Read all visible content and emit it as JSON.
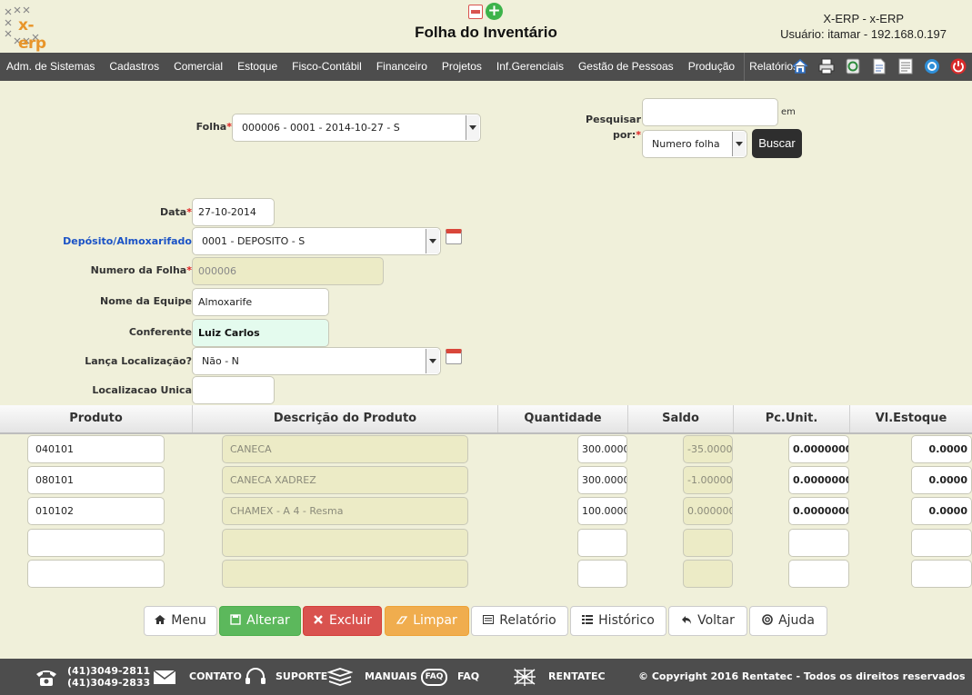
{
  "app": {
    "logo_text": "x-erp",
    "title": "Folha do Inventário",
    "user_line1": "X-ERP - x-ERP",
    "user_line2": "Usuário: itamar - 192.168.0.197"
  },
  "nav": {
    "items": [
      "Adm. de Sistemas",
      "Cadastros",
      "Comercial",
      "Estoque",
      "Fisco-Contábil",
      "Financeiro",
      "Projetos",
      "Inf.Gerenciais",
      "Gestão de Pessoas",
      "Produção",
      "Relatórios"
    ],
    "icons": [
      "home-icon",
      "print-icon",
      "recycle-icon",
      "document-icon",
      "list-icon",
      "help-icon",
      "power-icon"
    ]
  },
  "form": {
    "folha_label": "Folha",
    "folha_value": "000006 - 0001 - 2014-10-27 - S",
    "pesquisar_label": "Pesquisar",
    "por_label": "por:",
    "search_value": "",
    "em_label": "em",
    "search_by_value": "Numero folha",
    "buscar_label": "Buscar",
    "data_label": "Data",
    "data_value": "27-10-2014",
    "deposito_label": "Depósito/Almoxarifado",
    "deposito_value": "0001 - DEPOSITO - S",
    "numero_label": "Numero da Folha",
    "numero_value": "000006",
    "equipe_label": "Nome da Equipe",
    "equipe_value": "Almoxarife",
    "conferente_label": "Conferente",
    "conferente_value": "Luiz Carlos",
    "lanca_label": "Lança Localização?",
    "lanca_value": "Não - N",
    "localizacao_label": "Localizacao Unica",
    "localizacao_value": ""
  },
  "table": {
    "headers": [
      "Produto",
      "Descrição do Produto",
      "Quantidade",
      "Saldo",
      "Pc.Unit.",
      "Vl.Estoque"
    ],
    "rows": [
      {
        "produto": "040101",
        "descricao": "CANECA",
        "quantidade": "300.0000",
        "saldo": "-35.0000",
        "pcunit": "0.00000000",
        "vlestoque": "0.0000"
      },
      {
        "produto": "080101",
        "descricao": "CANECA  XADREZ",
        "quantidade": "300.0000",
        "saldo": "-1.00000",
        "pcunit": "0.00000000",
        "vlestoque": "0.0000"
      },
      {
        "produto": "010102",
        "descricao": "CHAMEX - A 4 - Resma",
        "quantidade": "100.0000",
        "saldo": "0.000000",
        "pcunit": "0.00000000",
        "vlestoque": "0.0000"
      },
      {
        "produto": "",
        "descricao": "",
        "quantidade": "",
        "saldo": "",
        "pcunit": "",
        "vlestoque": ""
      },
      {
        "produto": "",
        "descricao": "",
        "quantidade": "",
        "saldo": "",
        "pcunit": "",
        "vlestoque": ""
      }
    ]
  },
  "actions": {
    "menu": "Menu",
    "alterar": "Alterar",
    "excluir": "Excluir",
    "limpar": "Limpar",
    "relatorio": "Relatório",
    "historico": "Histórico",
    "voltar": "Voltar",
    "ajuda": "Ajuda"
  },
  "footer": {
    "phone1": "(41)3049-2811",
    "phone2": "(41)3049-2833",
    "contato": "CONTATO",
    "suporte": "SUPORTE",
    "manuais": "MANUAIS",
    "faq_badge": "FAQ",
    "faq": "FAQ",
    "rentatec": "RENTATEC",
    "copyright": "© Copyright 2016 Rentatec - Todos os direitos reservados"
  },
  "colors": {
    "background": "#f0f0da",
    "nav": "#4d4d4d",
    "alterar": "#5cb85c",
    "excluir": "#d9534f",
    "limpar": "#f0ad4e",
    "required": "#e02020",
    "link_label": "#1a52c6"
  }
}
